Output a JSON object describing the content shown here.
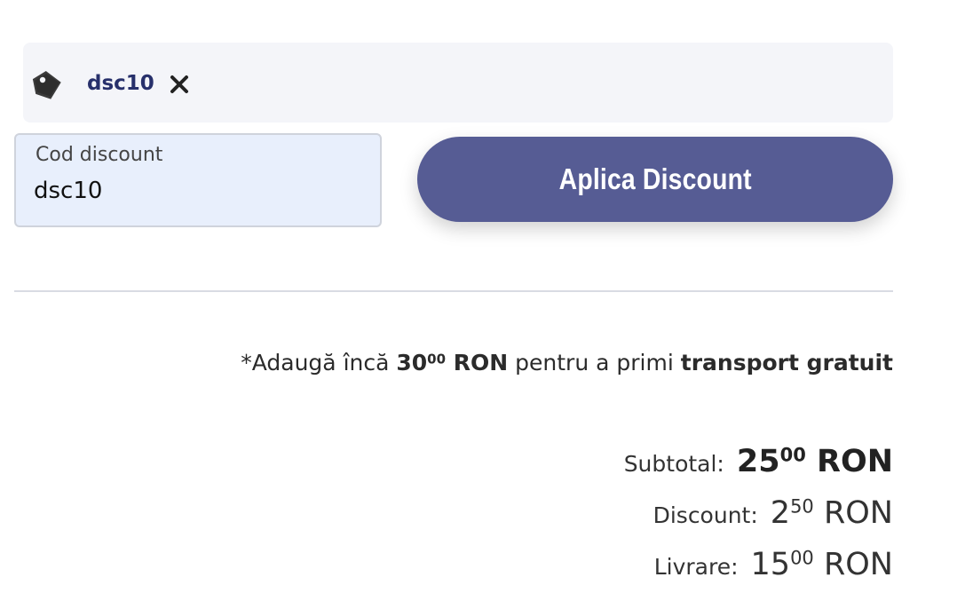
{
  "coupon": {
    "code": "dsc10",
    "tag_icon": "tag-icon",
    "remove_icon": "close-icon"
  },
  "discount_form": {
    "label": "Cod discount",
    "value": "dsc10",
    "button_label": "Aplica Discount",
    "button_color": "#565c94"
  },
  "shipping_note": {
    "prefix": "*Adaugă încă",
    "amount_int": "30",
    "amount_cents": "00",
    "currency": "RON",
    "middle": "pentru a primi",
    "emphasis": "transport gratuit"
  },
  "summary": {
    "subtotal": {
      "label": "Subtotal:",
      "int": "25",
      "cents": "00",
      "currency": "RON"
    },
    "discount": {
      "label": "Discount:",
      "int": "2",
      "cents": "50",
      "currency": "RON"
    },
    "shipping": {
      "label": "Livrare:",
      "int": "15",
      "cents": "00",
      "currency": "RON"
    }
  }
}
